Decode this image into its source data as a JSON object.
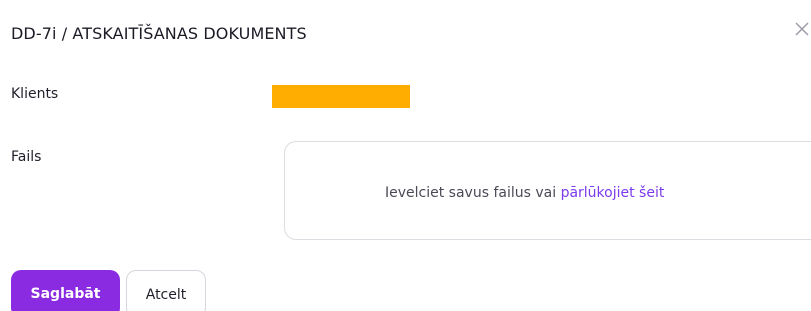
{
  "modal": {
    "title": "DD-7i / ATSKAITĪŠANAS DOKUMENTS",
    "close_icon": "close-icon"
  },
  "form": {
    "client_label": "Klients",
    "client_value_color": "#ffad00",
    "file_label": "Fails",
    "dropzone_text": "Ievelciet savus failus vai ",
    "browse_link": "pārlūkojiet šeit"
  },
  "actions": {
    "save_label": "Saglabāt",
    "cancel_label": "Atcelt"
  },
  "colors": {
    "primary": "#8a2be2",
    "link": "#7c3aed",
    "redacted": "#ffad00"
  }
}
